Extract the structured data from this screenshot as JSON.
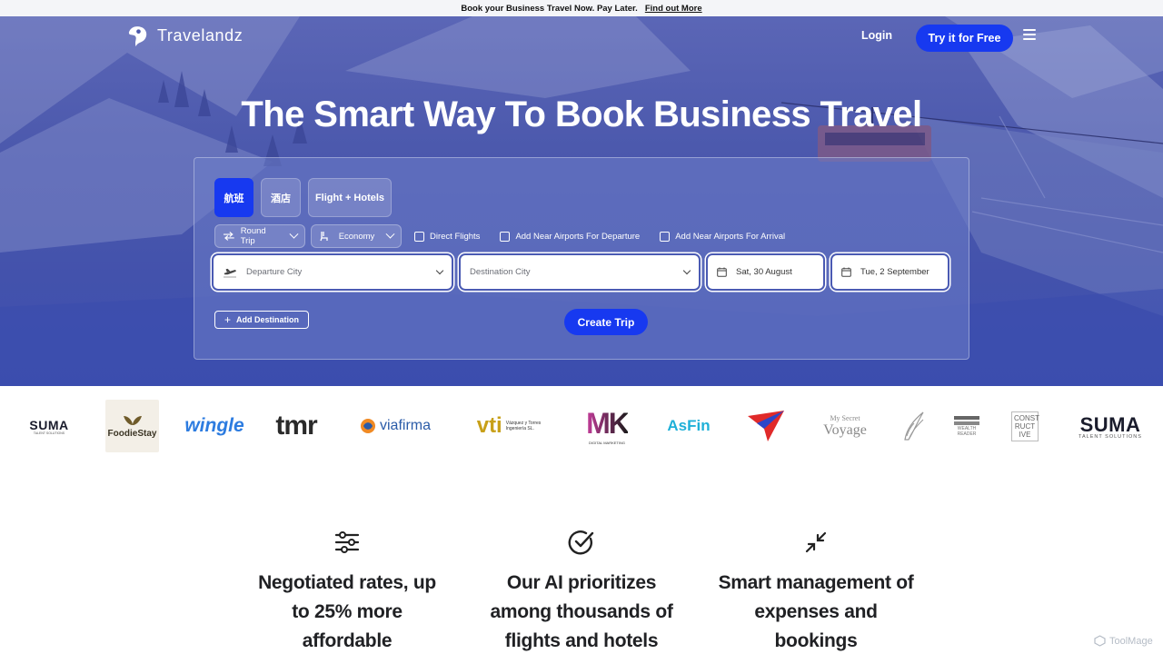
{
  "banner": {
    "text": "Book your Business Travel Now. Pay Later.",
    "link": "Find out More"
  },
  "nav": {
    "brand": "Travelandz",
    "login": "Login",
    "cta": "Try it for Free"
  },
  "hero": {
    "title": "The Smart Way To Book Business Travel"
  },
  "search": {
    "tabs": [
      {
        "label": "航班",
        "active": true
      },
      {
        "label": "酒店",
        "active": false
      },
      {
        "label": "Flight + Hotels",
        "active": false
      }
    ],
    "trip_type": "Round Trip",
    "cabin": "Economy",
    "checkboxes": [
      "Direct Flights",
      "Add Near Airports For Departure",
      "Add Near Airports For Arrival"
    ],
    "departure_placeholder": "Departure City",
    "destination_placeholder": "Destination City",
    "depart_date": "Sat, 30 August",
    "return_date": "Tue, 2 September",
    "add_destination": "Add Destination",
    "create_trip": "Create Trip"
  },
  "partners": {
    "suma1": "SUMA",
    "suma1_sub": "TALENT SOLUTIONS",
    "foodiestay": "FoodieStay",
    "wingle": "wingle",
    "tmr": "tmr",
    "viafirma": "viafirma",
    "vti": "vti",
    "vti_sub1": "Vázquez y Torres",
    "vti_sub2": "Ingeniería SL.",
    "mk": "MK",
    "mk_sub": "DIGITAL MARKETING",
    "asfin": "AsFin",
    "voyage1": "My Secret",
    "voyage2": "Voyage",
    "wealth1": "WEALTH",
    "wealth2": "READER",
    "constructive": "CONST RUCT IVE",
    "suma2": "SUMA",
    "suma2_sub": "TALENT SOLUTIONS"
  },
  "features": [
    {
      "icon": "sliders-icon",
      "text": "Negotiated rates, up to 25% more affordable"
    },
    {
      "icon": "check-circle-icon",
      "text": "Our AI prioritizes among thousands of flights and hotels"
    },
    {
      "icon": "minimize-icon",
      "text": "Smart management of expenses and bookings"
    }
  ],
  "watermark": "ToolMage",
  "colors": {
    "primary": "#1739f0",
    "hero": "#4352ac"
  }
}
